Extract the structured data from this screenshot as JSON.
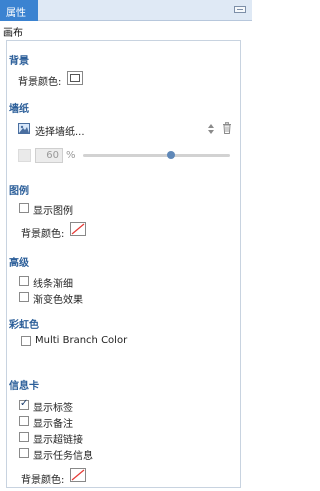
{
  "panel": {
    "tab_label": "属性",
    "canvas_label": "画布"
  },
  "background": {
    "section_title": "背景",
    "color_label": "背景颜色:"
  },
  "wallpaper": {
    "section_title": "墙纸",
    "select_label": "选择墙纸...",
    "opacity_value": "60",
    "opacity_unit": "%",
    "opacity_fraction": 0.6
  },
  "legend": {
    "section_title": "图例",
    "show_legend_label": "显示图例",
    "show_legend_checked": false,
    "color_label": "背景颜色:"
  },
  "advanced": {
    "section_title": "高级",
    "line_taper_label": "线条渐细",
    "line_taper_checked": false,
    "gradient_label": "渐变色效果",
    "gradient_checked": false
  },
  "rainbow": {
    "section_title": "彩虹色",
    "multi_branch_label": "Multi Branch Color",
    "multi_branch_checked": false
  },
  "info_card": {
    "section_title": "信息卡",
    "show_tags_label": "显示标签",
    "show_tags_checked": true,
    "show_notes_label": "显示备注",
    "show_notes_checked": false,
    "show_links_label": "显示超链接",
    "show_links_checked": false,
    "show_tasks_label": "显示任务信息",
    "show_tasks_checked": false,
    "color_label": "背景颜色:"
  },
  "colors": {
    "tab_bg": "#3b83d1",
    "section_title": "#2b5e99",
    "none_slash": "#e53935",
    "slider_thumb": "#5f88b8"
  }
}
